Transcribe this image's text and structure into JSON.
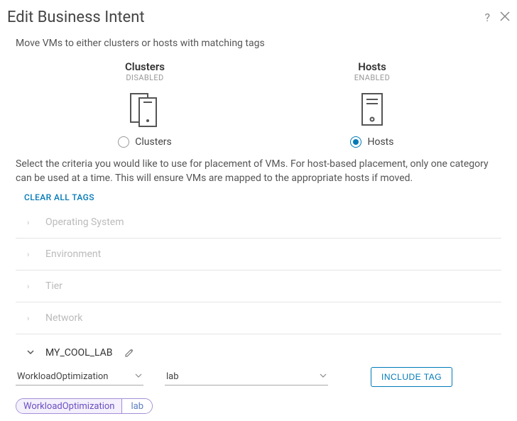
{
  "header": {
    "title": "Edit Business Intent"
  },
  "description": "Move VMs to either clusters or hosts with matching tags",
  "options": {
    "clusters": {
      "title": "Clusters",
      "status": "DISABLED",
      "radio_label": "Clusters",
      "selected": false
    },
    "hosts": {
      "title": "Hosts",
      "status": "ENABLED",
      "radio_label": "Hosts",
      "selected": true
    }
  },
  "criteria_description": "Select the criteria you would like to use for placement of VMs. For host-based placement, only one category can be used at a time. This will ensure VMs are mapped to the appropriate hosts if moved.",
  "clear_tags_label": "CLEAR ALL TAGS",
  "categories": [
    {
      "label": "Operating System",
      "expanded": false
    },
    {
      "label": "Environment",
      "expanded": false
    },
    {
      "label": "Tier",
      "expanded": false
    },
    {
      "label": "Network",
      "expanded": false
    },
    {
      "label": "MY_COOL_LAB",
      "expanded": true
    }
  ],
  "filter": {
    "category_value": "WorkloadOptimization",
    "tag_value": "lab",
    "include_label": "INCLUDE TAG"
  },
  "chips": [
    {
      "category": "WorkloadOptimization",
      "tag": "lab"
    }
  ]
}
